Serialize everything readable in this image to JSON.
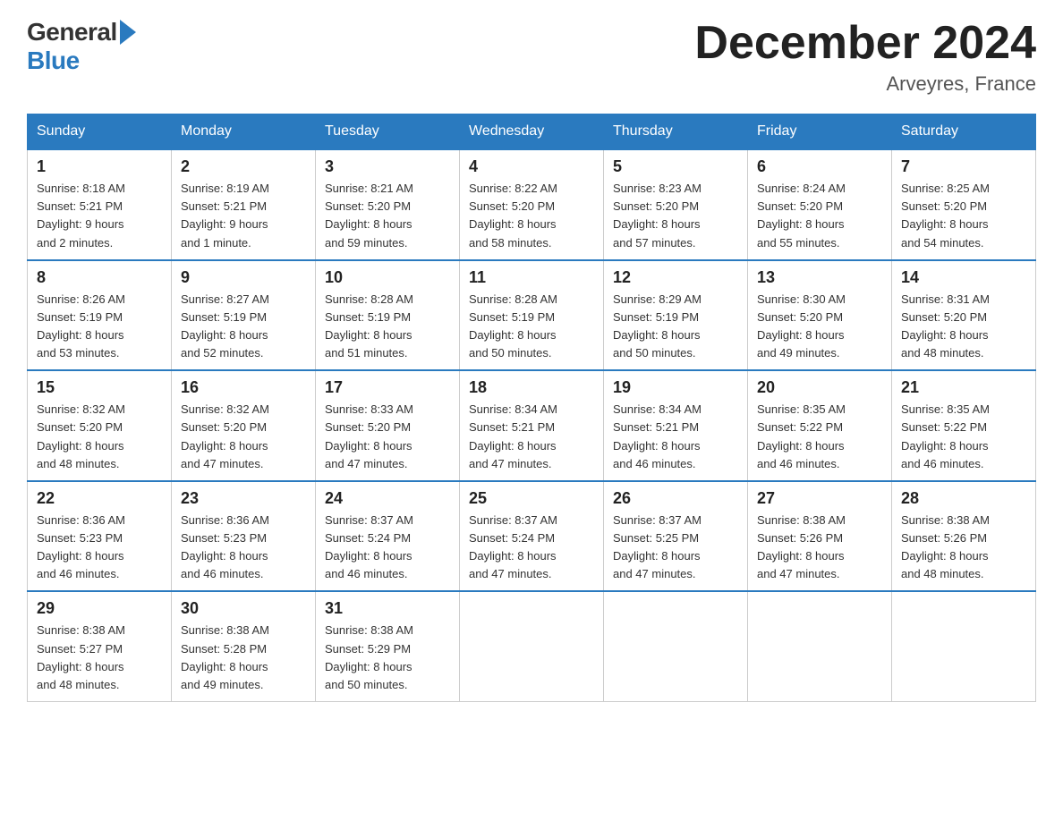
{
  "header": {
    "logo_general": "General",
    "logo_blue": "Blue",
    "month_title": "December 2024",
    "location": "Arveyres, France"
  },
  "days_of_week": [
    "Sunday",
    "Monday",
    "Tuesday",
    "Wednesday",
    "Thursday",
    "Friday",
    "Saturday"
  ],
  "weeks": [
    [
      {
        "day": "1",
        "info": "Sunrise: 8:18 AM\nSunset: 5:21 PM\nDaylight: 9 hours\nand 2 minutes."
      },
      {
        "day": "2",
        "info": "Sunrise: 8:19 AM\nSunset: 5:21 PM\nDaylight: 9 hours\nand 1 minute."
      },
      {
        "day": "3",
        "info": "Sunrise: 8:21 AM\nSunset: 5:20 PM\nDaylight: 8 hours\nand 59 minutes."
      },
      {
        "day": "4",
        "info": "Sunrise: 8:22 AM\nSunset: 5:20 PM\nDaylight: 8 hours\nand 58 minutes."
      },
      {
        "day": "5",
        "info": "Sunrise: 8:23 AM\nSunset: 5:20 PM\nDaylight: 8 hours\nand 57 minutes."
      },
      {
        "day": "6",
        "info": "Sunrise: 8:24 AM\nSunset: 5:20 PM\nDaylight: 8 hours\nand 55 minutes."
      },
      {
        "day": "7",
        "info": "Sunrise: 8:25 AM\nSunset: 5:20 PM\nDaylight: 8 hours\nand 54 minutes."
      }
    ],
    [
      {
        "day": "8",
        "info": "Sunrise: 8:26 AM\nSunset: 5:19 PM\nDaylight: 8 hours\nand 53 minutes."
      },
      {
        "day": "9",
        "info": "Sunrise: 8:27 AM\nSunset: 5:19 PM\nDaylight: 8 hours\nand 52 minutes."
      },
      {
        "day": "10",
        "info": "Sunrise: 8:28 AM\nSunset: 5:19 PM\nDaylight: 8 hours\nand 51 minutes."
      },
      {
        "day": "11",
        "info": "Sunrise: 8:28 AM\nSunset: 5:19 PM\nDaylight: 8 hours\nand 50 minutes."
      },
      {
        "day": "12",
        "info": "Sunrise: 8:29 AM\nSunset: 5:19 PM\nDaylight: 8 hours\nand 50 minutes."
      },
      {
        "day": "13",
        "info": "Sunrise: 8:30 AM\nSunset: 5:20 PM\nDaylight: 8 hours\nand 49 minutes."
      },
      {
        "day": "14",
        "info": "Sunrise: 8:31 AM\nSunset: 5:20 PM\nDaylight: 8 hours\nand 48 minutes."
      }
    ],
    [
      {
        "day": "15",
        "info": "Sunrise: 8:32 AM\nSunset: 5:20 PM\nDaylight: 8 hours\nand 48 minutes."
      },
      {
        "day": "16",
        "info": "Sunrise: 8:32 AM\nSunset: 5:20 PM\nDaylight: 8 hours\nand 47 minutes."
      },
      {
        "day": "17",
        "info": "Sunrise: 8:33 AM\nSunset: 5:20 PM\nDaylight: 8 hours\nand 47 minutes."
      },
      {
        "day": "18",
        "info": "Sunrise: 8:34 AM\nSunset: 5:21 PM\nDaylight: 8 hours\nand 47 minutes."
      },
      {
        "day": "19",
        "info": "Sunrise: 8:34 AM\nSunset: 5:21 PM\nDaylight: 8 hours\nand 46 minutes."
      },
      {
        "day": "20",
        "info": "Sunrise: 8:35 AM\nSunset: 5:22 PM\nDaylight: 8 hours\nand 46 minutes."
      },
      {
        "day": "21",
        "info": "Sunrise: 8:35 AM\nSunset: 5:22 PM\nDaylight: 8 hours\nand 46 minutes."
      }
    ],
    [
      {
        "day": "22",
        "info": "Sunrise: 8:36 AM\nSunset: 5:23 PM\nDaylight: 8 hours\nand 46 minutes."
      },
      {
        "day": "23",
        "info": "Sunrise: 8:36 AM\nSunset: 5:23 PM\nDaylight: 8 hours\nand 46 minutes."
      },
      {
        "day": "24",
        "info": "Sunrise: 8:37 AM\nSunset: 5:24 PM\nDaylight: 8 hours\nand 46 minutes."
      },
      {
        "day": "25",
        "info": "Sunrise: 8:37 AM\nSunset: 5:24 PM\nDaylight: 8 hours\nand 47 minutes."
      },
      {
        "day": "26",
        "info": "Sunrise: 8:37 AM\nSunset: 5:25 PM\nDaylight: 8 hours\nand 47 minutes."
      },
      {
        "day": "27",
        "info": "Sunrise: 8:38 AM\nSunset: 5:26 PM\nDaylight: 8 hours\nand 47 minutes."
      },
      {
        "day": "28",
        "info": "Sunrise: 8:38 AM\nSunset: 5:26 PM\nDaylight: 8 hours\nand 48 minutes."
      }
    ],
    [
      {
        "day": "29",
        "info": "Sunrise: 8:38 AM\nSunset: 5:27 PM\nDaylight: 8 hours\nand 48 minutes."
      },
      {
        "day": "30",
        "info": "Sunrise: 8:38 AM\nSunset: 5:28 PM\nDaylight: 8 hours\nand 49 minutes."
      },
      {
        "day": "31",
        "info": "Sunrise: 8:38 AM\nSunset: 5:29 PM\nDaylight: 8 hours\nand 50 minutes."
      },
      null,
      null,
      null,
      null
    ]
  ]
}
